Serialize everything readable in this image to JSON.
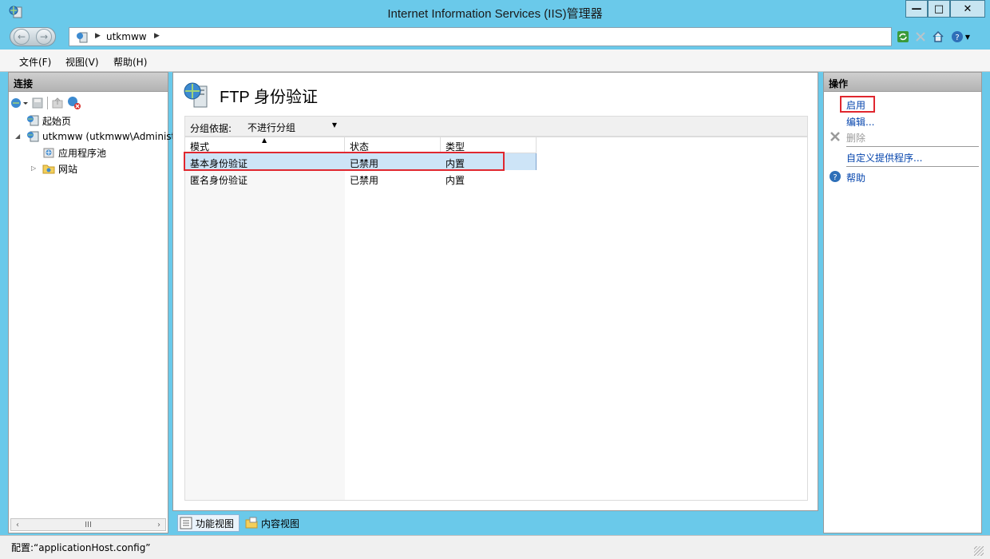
{
  "window": {
    "title": "Internet Information Services (IIS)管理器",
    "buttons": {
      "minimize": "—",
      "maximize": "□",
      "close": "✕"
    }
  },
  "address": {
    "crumb": "utkmww"
  },
  "menu": {
    "items": [
      "文件(F)",
      "视图(V)",
      "帮助(H)"
    ]
  },
  "connections": {
    "header": "连接",
    "tree": [
      {
        "label": "起始页",
        "icon": "start-page-icon"
      },
      {
        "label": "utkmww (utkmww\\Administ",
        "icon": "server-icon"
      },
      {
        "label": "应用程序池",
        "icon": "app-pool-icon"
      },
      {
        "label": "网站",
        "icon": "sites-folder-icon"
      }
    ],
    "scroll_thumb": "III"
  },
  "feature": {
    "title": "FTP 身份验证",
    "group_label": "分组依据:",
    "group_value": "不进行分组",
    "columns": [
      "模式",
      "状态",
      "类型"
    ],
    "rows": [
      {
        "mode": "基本身份验证",
        "status": "已禁用",
        "type": "内置",
        "selected": true
      },
      {
        "mode": "匿名身份验证",
        "status": "已禁用",
        "type": "内置",
        "selected": false
      }
    ]
  },
  "tabs": {
    "feature_view": "功能视图",
    "content_view": "内容视图"
  },
  "actions": {
    "header": "操作",
    "enable": "启用",
    "edit": "编辑...",
    "delete": "删除",
    "custom_provider": "自定义提供程序...",
    "help": "帮助"
  },
  "status": {
    "text": "配置:“applicationHost.config”"
  },
  "colors": {
    "titlebar": "#6ac9ea",
    "highlight": "#e0272f",
    "link": "#0645ad",
    "selection": "#cde4f7"
  }
}
